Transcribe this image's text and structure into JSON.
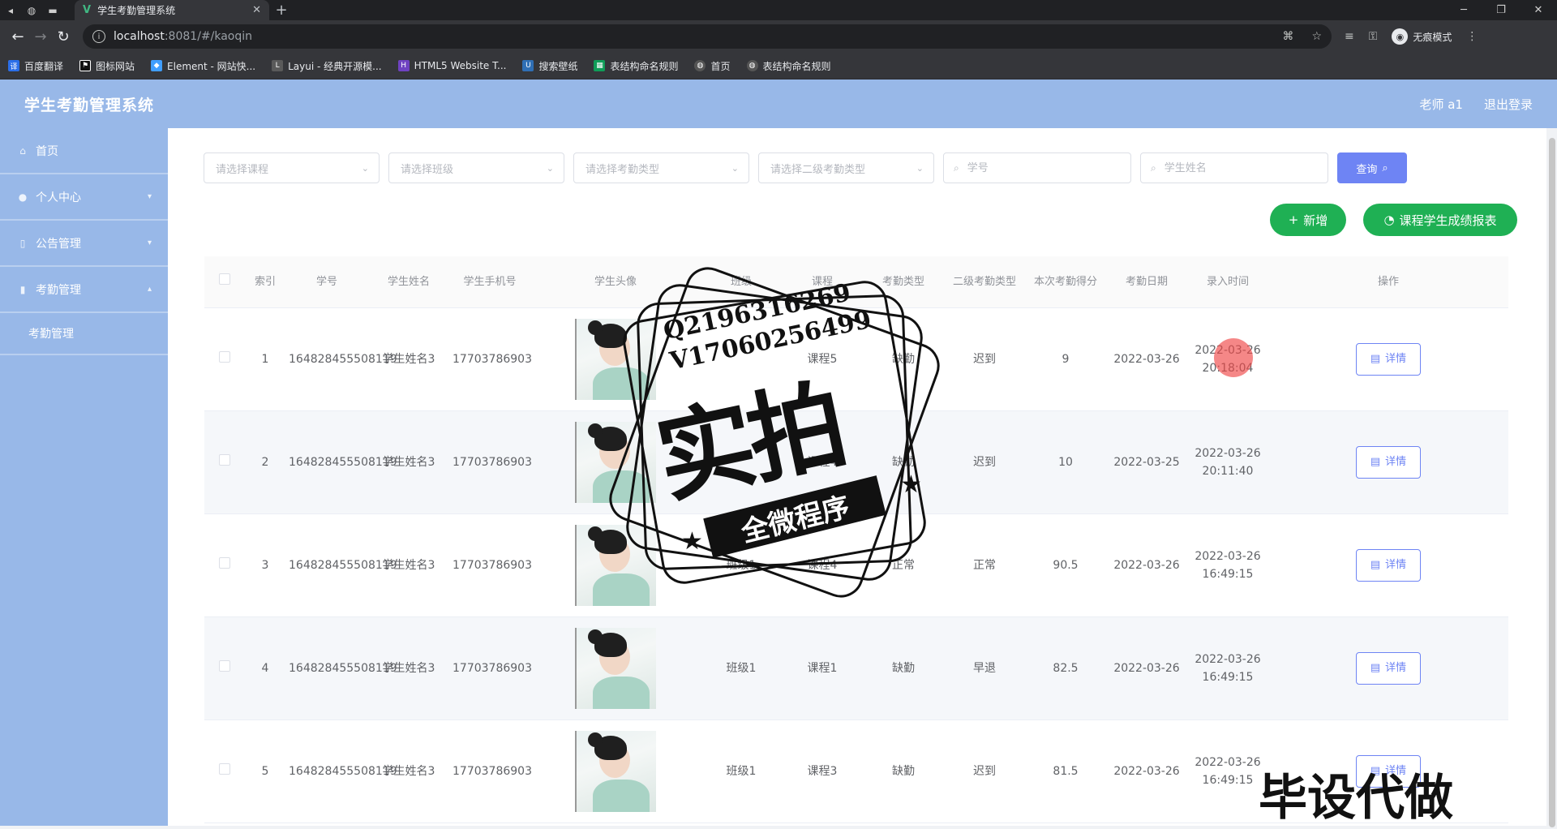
{
  "browser": {
    "tab_title": "学生考勤管理系统",
    "url_host": "localhost",
    "url_path": ":8081/#/kaoqin",
    "profile_label": "无痕模式",
    "bookmarks": [
      "百度翻译",
      "图标网站",
      "Element - 网站快...",
      "Layui - 经典开源模...",
      "HTML5 Website T...",
      "搜索壁纸",
      "表结构命名规则",
      "首页",
      "表结构命名规则"
    ]
  },
  "header": {
    "title": "学生考勤管理系统",
    "user": "老师 a1",
    "logout": "退出登录"
  },
  "sidebar": {
    "items": [
      {
        "label": "首页",
        "icon": "home-icon"
      },
      {
        "label": "个人中心",
        "icon": "user-icon"
      },
      {
        "label": "公告管理",
        "icon": "notice-icon"
      },
      {
        "label": "考勤管理",
        "icon": "chart-icon"
      }
    ],
    "sub_item": "考勤管理"
  },
  "filters": {
    "course_placeholder": "请选择课程",
    "class_placeholder": "请选择班级",
    "type_placeholder": "请选择考勤类型",
    "type2_placeholder": "请选择二级考勤类型",
    "student_no_placeholder": "学号",
    "student_name_placeholder": "学生姓名",
    "query_label": "查询"
  },
  "actions": {
    "add_label": "新增",
    "report_label": "课程学生成绩报表"
  },
  "table": {
    "headers": {
      "index": "索引",
      "student_no": "学号",
      "name": "学生姓名",
      "phone": "学生手机号",
      "avatar": "学生头像",
      "class": "班级",
      "course": "课程",
      "type": "考勤类型",
      "type2": "二级考勤类型",
      "score": "本次考勤得分",
      "date": "考勤日期",
      "time": "录入时间",
      "op": "操作"
    },
    "detail_label": "详情",
    "rows": [
      {
        "index": "1",
        "student_no": "164828455508119",
        "name": "学生姓名3",
        "phone": "17703786903",
        "class": "",
        "course": "课程5",
        "type": "缺勤",
        "type2": "迟到",
        "score": "9",
        "date": "2022-03-26",
        "time": "2022-03-26 20:18:04"
      },
      {
        "index": "2",
        "student_no": "164828455508119",
        "name": "学生姓名3",
        "phone": "17703786903",
        "class": "",
        "course": "课程4",
        "type": "缺勤",
        "type2": "迟到",
        "score": "10",
        "date": "2022-03-25",
        "time": "2022-03-26 20:11:40"
      },
      {
        "index": "3",
        "student_no": "164828455508119",
        "name": "学生姓名3",
        "phone": "17703786903",
        "class": "班级1",
        "course": "课程4",
        "type": "正常",
        "type2": "正常",
        "score": "90.5",
        "date": "2022-03-26",
        "time": "2022-03-26 16:49:15"
      },
      {
        "index": "4",
        "student_no": "164828455508119",
        "name": "学生姓名3",
        "phone": "17703786903",
        "class": "班级1",
        "course": "课程1",
        "type": "缺勤",
        "type2": "早退",
        "score": "82.5",
        "date": "2022-03-26",
        "time": "2022-03-26 16:49:15"
      },
      {
        "index": "5",
        "student_no": "164828455508119",
        "name": "学生姓名3",
        "phone": "17703786903",
        "class": "班级1",
        "course": "课程3",
        "type": "缺勤",
        "type2": "迟到",
        "score": "81.5",
        "date": "2022-03-26",
        "time": "2022-03-26 16:49:15"
      }
    ]
  },
  "overlay": {
    "stamp_qq": "Q2196316269",
    "stamp_v": "V17060256499",
    "stamp_main": "实拍",
    "stamp_ribbon": "全微程序",
    "watermark": "毕设代做"
  },
  "colors": {
    "header_bg": "#98b8e8",
    "primary": "#6e84f4",
    "success": "#1fb054"
  }
}
